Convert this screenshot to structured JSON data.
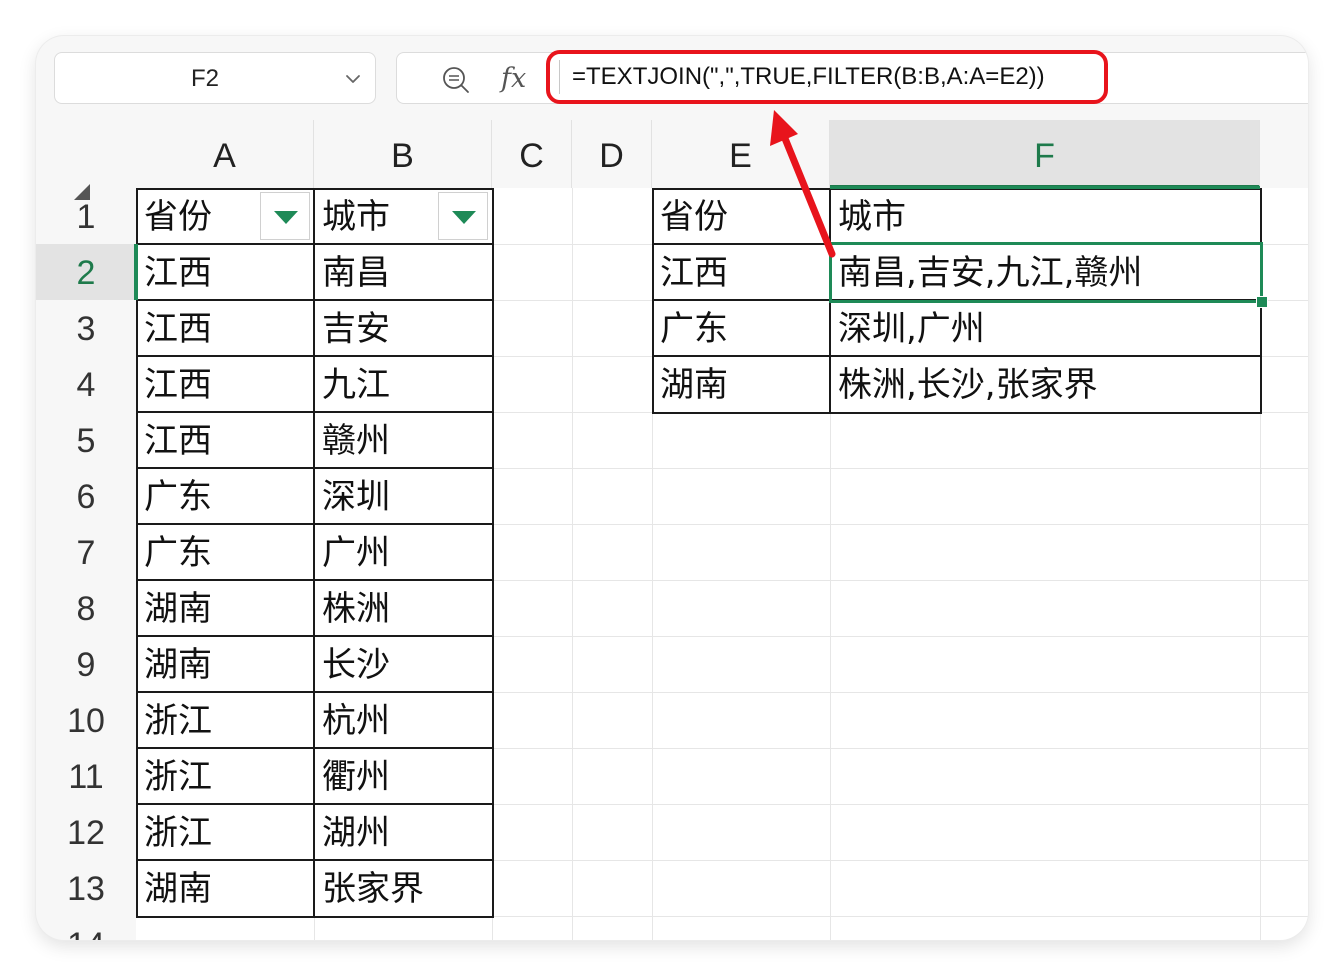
{
  "formula_bar": {
    "name_box": "F2",
    "fx_label": "fx",
    "formula": "=TEXTJOIN(\",\",TRUE,FILTER(B:B,A:A=E2))"
  },
  "columns": [
    "A",
    "B",
    "C",
    "D",
    "E",
    "F"
  ],
  "rows": [
    "1",
    "2",
    "3",
    "4",
    "5",
    "6",
    "7",
    "8",
    "9",
    "10",
    "11",
    "12",
    "13",
    "14"
  ],
  "source_table": {
    "header": [
      "省份",
      "城市"
    ],
    "data": [
      [
        "江西",
        "南昌"
      ],
      [
        "江西",
        "吉安"
      ],
      [
        "江西",
        "九江"
      ],
      [
        "江西",
        "赣州"
      ],
      [
        "广东",
        "深圳"
      ],
      [
        "广东",
        "广州"
      ],
      [
        "湖南",
        "株洲"
      ],
      [
        "湖南",
        "长沙"
      ],
      [
        "浙江",
        "杭州"
      ],
      [
        "浙江",
        "衢州"
      ],
      [
        "浙江",
        "湖州"
      ],
      [
        "湖南",
        "张家界"
      ]
    ]
  },
  "result_table": {
    "header": [
      "省份",
      "城市"
    ],
    "data": [
      [
        "江西",
        "南昌,吉安,九江,赣州"
      ],
      [
        "广东",
        "深圳,广州"
      ],
      [
        "湖南",
        "株洲,长沙,张家界"
      ]
    ]
  },
  "colors": {
    "accent_green": "#1e8a57",
    "highlight_red": "#e8141c"
  }
}
